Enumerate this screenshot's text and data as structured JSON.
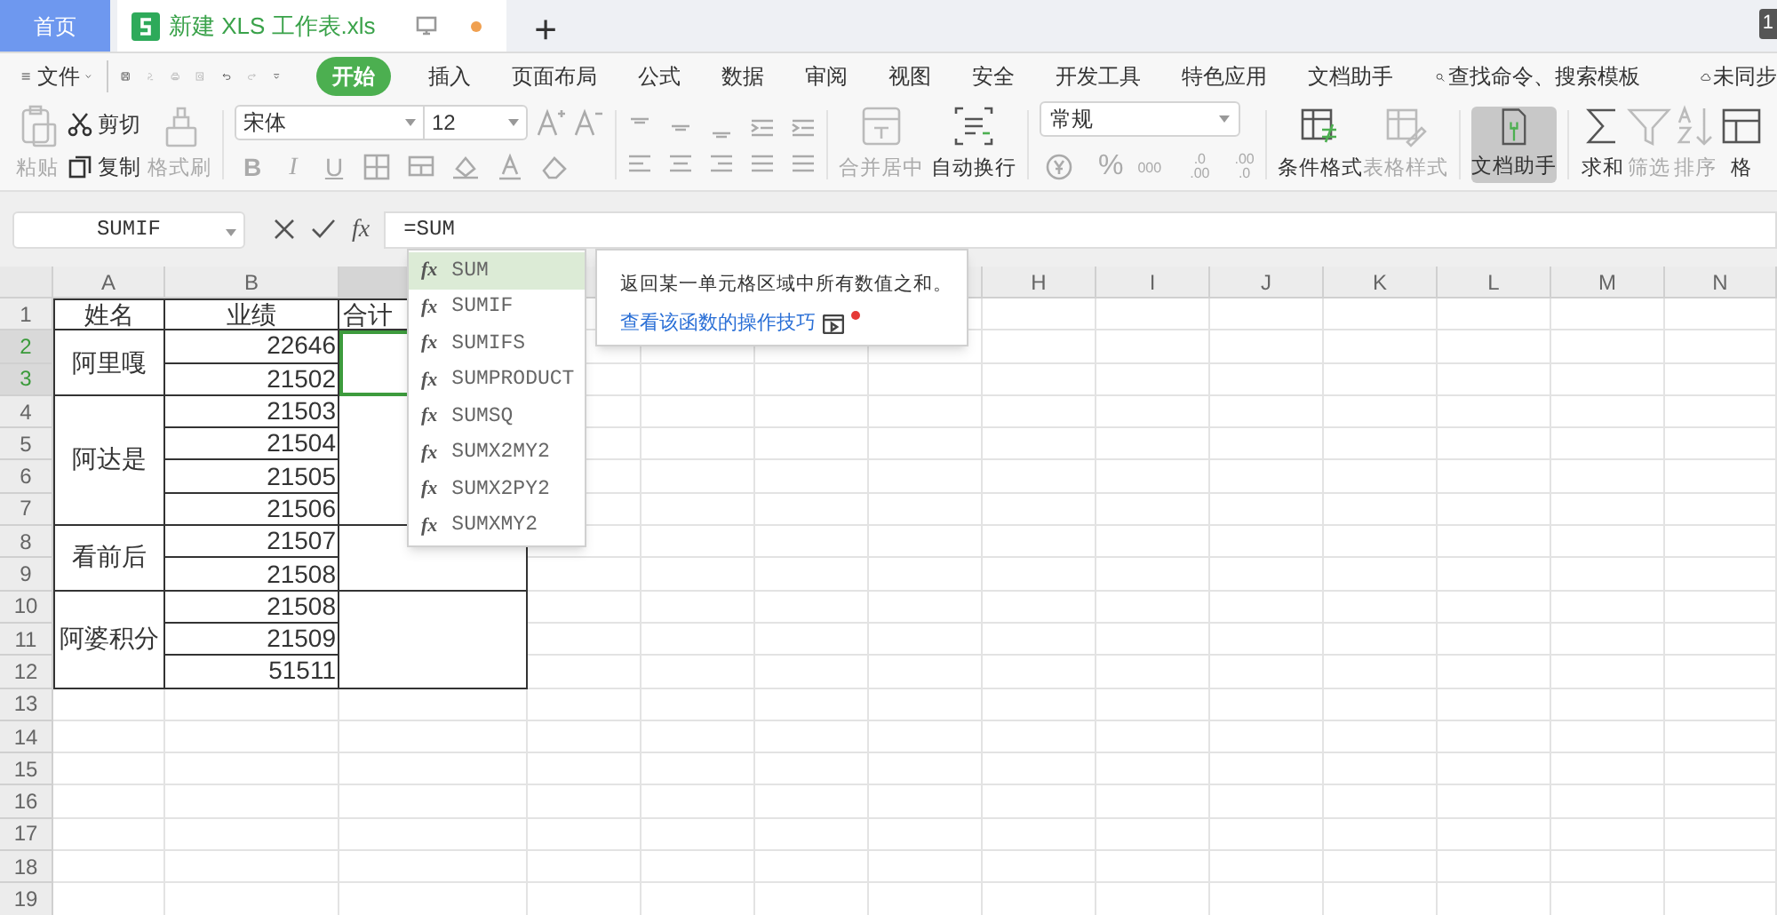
{
  "tabs": [
    {
      "label": "首页",
      "selected": false,
      "kind": "home"
    },
    {
      "label": "新建 XLS 工作表.xls",
      "selected": true,
      "kind": "doc",
      "modified": true
    }
  ],
  "new_tab": "+",
  "corner_badge": "1",
  "menu": {
    "file": "文件",
    "items": [
      {
        "label": "开始",
        "selected": true
      },
      {
        "label": "插入",
        "selected": false
      },
      {
        "label": "页面布局",
        "selected": false
      },
      {
        "label": "公式",
        "selected": false
      },
      {
        "label": "数据",
        "selected": false
      },
      {
        "label": "审阅",
        "selected": false
      },
      {
        "label": "视图",
        "selected": false
      },
      {
        "label": "安全",
        "selected": false
      },
      {
        "label": "开发工具",
        "selected": false
      },
      {
        "label": "特色应用",
        "selected": false
      },
      {
        "label": "文档助手",
        "selected": false
      }
    ],
    "search": "查找命令、搜索模板",
    "sync": "未同步"
  },
  "ribbon": {
    "paste": {
      "label": "粘贴",
      "disabled": true
    },
    "cut": {
      "label": "剪切",
      "disabled": false
    },
    "copy": {
      "label": "复制",
      "disabled": false
    },
    "painter": {
      "label": "格式刷",
      "disabled": true
    },
    "font_name": "宋体",
    "font_size": "12",
    "font_buttons": [
      "B",
      "I",
      "U"
    ],
    "merge": {
      "label": "合并居中",
      "disabled": true
    },
    "wrap": {
      "label": "自动换行",
      "disabled": false
    },
    "number_format": "常规",
    "number_buttons": [
      "%",
      "000",
      ".0",
      ".00",
      ".00",
      ".0"
    ],
    "large": [
      {
        "label": "条件格式",
        "disabled": false,
        "selected": false
      },
      {
        "label": "表格样式",
        "disabled": true,
        "selected": false
      },
      {
        "label": "文档助手",
        "disabled": false,
        "selected": true
      },
      {
        "label": "求和",
        "disabled": false,
        "selected": false
      },
      {
        "label": "筛选",
        "disabled": true,
        "selected": false
      },
      {
        "label": "排序",
        "disabled": true,
        "selected": false
      },
      {
        "label": "格",
        "disabled": false,
        "selected": false
      }
    ]
  },
  "formula_bar": {
    "name_box": "SUMIF",
    "formula": "=SUM"
  },
  "columns": [
    {
      "label": "A"
    },
    {
      "label": "B"
    },
    {},
    {},
    {},
    {},
    {},
    {
      "label": "H"
    },
    {
      "label": "I"
    },
    {
      "label": "J"
    },
    {
      "label": "K"
    },
    {
      "label": "L"
    },
    {
      "label": "M"
    },
    {
      "label": "N"
    }
  ],
  "row_numbers": [
    {
      "label": "1",
      "selected": false
    },
    {
      "label": "2",
      "selected": true
    },
    {
      "label": "3",
      "selected": true
    },
    {
      "label": "4",
      "selected": false
    },
    {
      "label": "5",
      "selected": false
    },
    {
      "label": "6",
      "selected": false
    },
    {
      "label": "7",
      "selected": false
    },
    {
      "label": "8",
      "selected": false
    },
    {
      "label": "9",
      "selected": false
    },
    {
      "label": "10",
      "selected": false
    },
    {
      "label": "11",
      "selected": false
    },
    {
      "label": "12",
      "selected": false
    },
    {
      "label": "13",
      "selected": false
    },
    {
      "label": "14",
      "selected": false
    },
    {
      "label": "15",
      "selected": false
    },
    {
      "label": "16",
      "selected": false
    },
    {
      "label": "17",
      "selected": false
    },
    {
      "label": "18",
      "selected": false
    },
    {
      "label": "19",
      "selected": false
    }
  ],
  "table": {
    "header": [
      "姓名",
      "业绩",
      "合计"
    ],
    "groups": [
      {
        "name": "阿里嘎",
        "values": [
          "22646",
          "21502"
        ],
        "selected": true
      },
      {
        "name": "阿达是",
        "values": [
          "21503",
          "21504",
          "21505",
          "21506"
        ],
        "selected": false
      },
      {
        "name": "看前后",
        "values": [
          "21507",
          "21508"
        ],
        "selected": false
      },
      {
        "name": "阿婆积分",
        "values": [
          "21508",
          "21509",
          "51511"
        ],
        "selected": false
      }
    ]
  },
  "autocomplete": [
    {
      "prefix": "fx",
      "label": "SUM",
      "selected": true
    },
    {
      "prefix": "fx",
      "label": "SUMIF",
      "selected": false
    },
    {
      "prefix": "fx",
      "label": "SUMIFS",
      "selected": false
    },
    {
      "prefix": "fx",
      "label": "SUMPRODUCT",
      "selected": false
    },
    {
      "prefix": "fx",
      "label": "SUMSQ",
      "selected": false
    },
    {
      "prefix": "fx",
      "label": "SUMX2MY2",
      "selected": false
    },
    {
      "prefix": "fx",
      "label": "SUMX2PY2",
      "selected": false
    },
    {
      "prefix": "fx",
      "label": "SUMXMY2",
      "selected": false
    }
  ],
  "fx_label": "fx",
  "tooltip": {
    "description": "返回某一单元格区域中所有数值之和。",
    "link": "查看该函数的操作技巧"
  }
}
